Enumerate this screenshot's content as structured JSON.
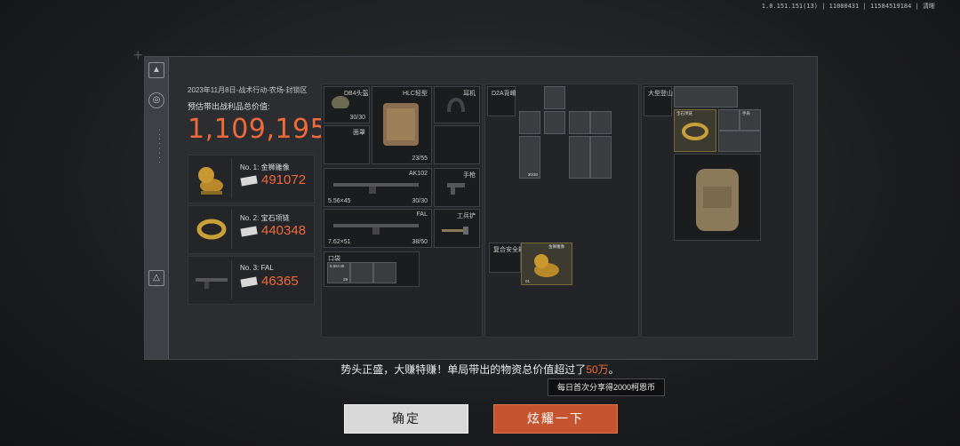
{
  "version_text": "1.0.151.151(13) | 11080431 | 11584519184 | 清晰",
  "summary": {
    "date_line": "2023年11月8日-战术行动-农场-封锁区",
    "estimate_label": "预估带出战利品总价值:",
    "total_value": "1,109,195"
  },
  "top_items": [
    {
      "rank": "No. 1: 金狮雕像",
      "value": "491072"
    },
    {
      "rank": "No. 2: 宝石项链",
      "value": "440348"
    },
    {
      "rank": "No. 3: FAL",
      "value": "46365"
    }
  ],
  "gear": {
    "helmet_label": "DB4头盔",
    "helmet_durability": "30/30",
    "armor_label": "HLC轻型",
    "armor_durability": "23/55",
    "ear_label": "耳机",
    "face_label": "面罩",
    "primary_label": "AK102",
    "primary_caliber": "5.56×45",
    "primary_ammo": "30/30",
    "pistol_label": "手枪",
    "secondary_label": "FAL",
    "secondary_caliber": "7.62×51",
    "secondary_ammo": "38/50",
    "tool_label": "工兵铲",
    "pocket_label": "口袋",
    "pocket_ammo_label": "5.56×45",
    "pocket_ammo_count": "29"
  },
  "rig": {
    "title": "D2A背嵴",
    "safe_box_label": "复合安全箱",
    "lion_label": "金狮雕像",
    "lion_count": "01",
    "gun_count": "30/30"
  },
  "backpack": {
    "title": "大型登山",
    "necklace_label": "宝石项链",
    "watch_label": "手表"
  },
  "message": {
    "prefix": "势头正盛，大赚特赚！单局带出的物资总价值超过了",
    "highlight": "50万",
    "suffix": "。"
  },
  "tooltip": "每日首次分享得2000柯恩币",
  "buttons": {
    "confirm": "确定",
    "share": "炫耀一下"
  },
  "colors": {
    "accent": "#ee6a3a",
    "share_button": "#c45530",
    "confirm_button": "#d9d9d9"
  }
}
